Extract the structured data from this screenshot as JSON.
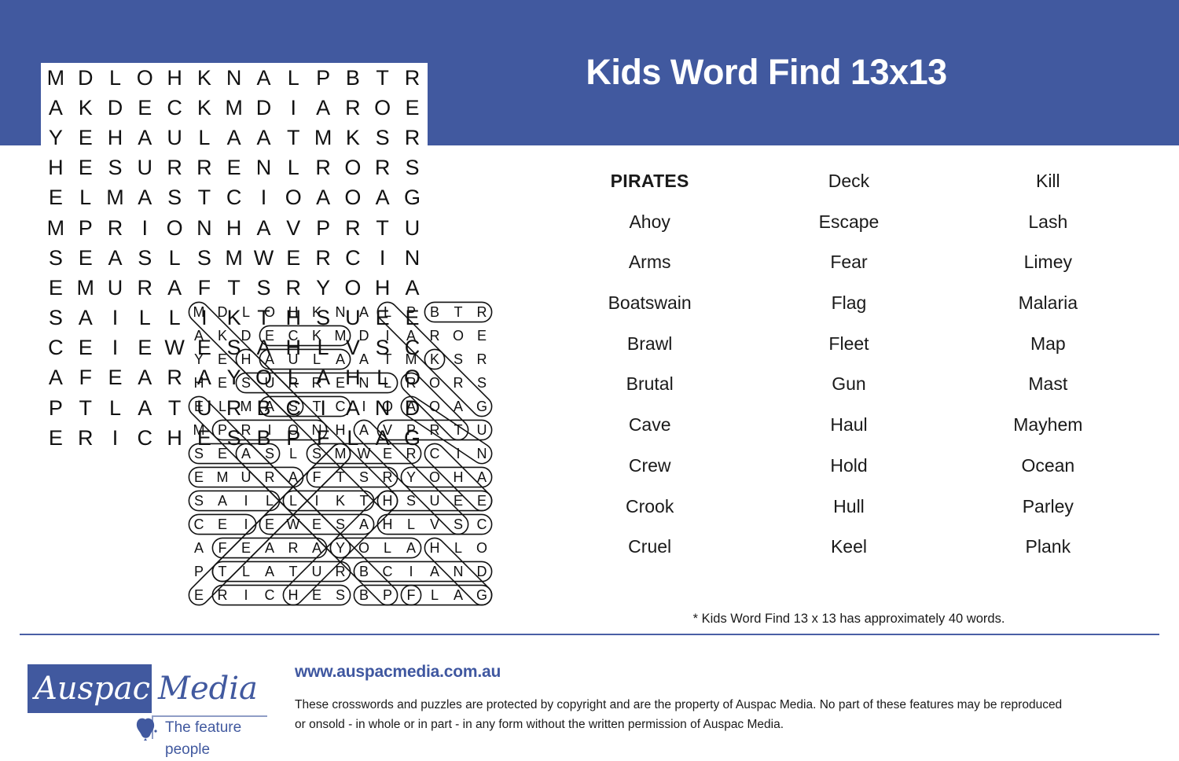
{
  "header": {
    "title": "Kids Word Find 13x13",
    "background_color": "#41599f",
    "title_color": "#ffffff"
  },
  "grid": {
    "size": "13x13",
    "rows": [
      [
        "M",
        "D",
        "L",
        "O",
        "H",
        "K",
        "N",
        "A",
        "L",
        "P",
        "B",
        "T",
        "R"
      ],
      [
        "A",
        "K",
        "D",
        "E",
        "C",
        "K",
        "M",
        "D",
        "I",
        "A",
        "R",
        "O",
        "E"
      ],
      [
        "Y",
        "E",
        "H",
        "A",
        "U",
        "L",
        "A",
        "A",
        "T",
        "M",
        "K",
        "S",
        "R"
      ],
      [
        "H",
        "E",
        "S",
        "U",
        "R",
        "R",
        "E",
        "N",
        "L",
        "R",
        "O",
        "R",
        "S"
      ],
      [
        "E",
        "L",
        "M",
        "A",
        "S",
        "T",
        "C",
        "I",
        "O",
        "A",
        "O",
        "A",
        "G"
      ],
      [
        "M",
        "P",
        "R",
        "I",
        "O",
        "N",
        "H",
        "A",
        "V",
        "P",
        "R",
        "T",
        "U"
      ],
      [
        "S",
        "E",
        "A",
        "S",
        "L",
        "S",
        "M",
        "W",
        "E",
        "R",
        "C",
        "I",
        "N"
      ],
      [
        "E",
        "M",
        "U",
        "R",
        "A",
        "F",
        "T",
        "S",
        "R",
        "Y",
        "O",
        "H",
        "A"
      ],
      [
        "S",
        "A",
        "I",
        "L",
        "L",
        "I",
        "K",
        "T",
        "H",
        "S",
        "U",
        "E",
        "E"
      ],
      [
        "C",
        "E",
        "I",
        "E",
        "W",
        "E",
        "S",
        "A",
        "H",
        "L",
        "V",
        "S",
        "C"
      ],
      [
        "A",
        "F",
        "E",
        "A",
        "R",
        "A",
        "Y",
        "O",
        "L",
        "A",
        "H",
        "L",
        "O"
      ],
      [
        "P",
        "T",
        "L",
        "A",
        "T",
        "U",
        "R",
        "B",
        "C",
        "I",
        "A",
        "N",
        "D"
      ],
      [
        "E",
        "R",
        "I",
        "C",
        "H",
        "E",
        "S",
        "B",
        "P",
        "F",
        "L",
        "A",
        "G"
      ]
    ]
  },
  "solution": {
    "caption": "answer-key-overlay",
    "rows": [
      [
        "M",
        "D",
        "L",
        "O",
        "H",
        "K",
        "N",
        "A",
        "L",
        "P",
        "B",
        "T",
        "R"
      ],
      [
        "A",
        "K",
        "D",
        "E",
        "C",
        "K",
        "M",
        "D",
        "I",
        "A",
        "R",
        "O",
        "E"
      ],
      [
        "Y",
        "E",
        "H",
        "A",
        "U",
        "L",
        "A",
        "A",
        "T",
        "M",
        "K",
        "S",
        "R"
      ],
      [
        "H",
        "E",
        "S",
        "U",
        "R",
        "R",
        "E",
        "N",
        "L",
        "R",
        "O",
        "R",
        "S"
      ],
      [
        "E",
        "L",
        "M",
        "A",
        "S",
        "T",
        "C",
        "I",
        "O",
        "A",
        "O",
        "A",
        "G"
      ],
      [
        "M",
        "P",
        "R",
        "I",
        "O",
        "N",
        "H",
        "A",
        "V",
        "P",
        "R",
        "T",
        "U"
      ],
      [
        "S",
        "E",
        "A",
        "S",
        "L",
        "S",
        "M",
        "W",
        "E",
        "R",
        "C",
        "I",
        "N"
      ],
      [
        "E",
        "M",
        "U",
        "R",
        "A",
        "F",
        "T",
        "S",
        "R",
        "Y",
        "O",
        "H",
        "A"
      ],
      [
        "S",
        "A",
        "I",
        "L",
        "L",
        "I",
        "K",
        "T",
        "H",
        "S",
        "U",
        "E",
        "E"
      ],
      [
        "C",
        "E",
        "I",
        "E",
        "W",
        "E",
        "S",
        "A",
        "H",
        "L",
        "V",
        "S",
        "C"
      ],
      [
        "A",
        "F",
        "E",
        "A",
        "R",
        "A",
        "Y",
        "O",
        "L",
        "A",
        "H",
        "L",
        "O"
      ],
      [
        "P",
        "T",
        "L",
        "A",
        "T",
        "U",
        "R",
        "B",
        "C",
        "I",
        "A",
        "N",
        "D"
      ],
      [
        "E",
        "R",
        "I",
        "C",
        "H",
        "E",
        "S",
        "B",
        "P",
        "F",
        "L",
        "A",
        "G"
      ]
    ]
  },
  "wordlist": {
    "heading": "PIRATES",
    "columns": [
      [
        "PIRATES",
        "Ahoy",
        "Arms",
        "Boatswain",
        "Brawl",
        "Brutal",
        "Cave",
        "Crew",
        "Crook",
        "Cruel"
      ],
      [
        "Deck",
        "Escape",
        "Fear",
        "Flag",
        "Fleet",
        "Gun",
        "Haul",
        "Hold",
        "Hull",
        "Keel"
      ],
      [
        "Kill",
        "Lash",
        "Limey",
        "Malaria",
        "Map",
        "Mast",
        "Mayhem",
        "Ocean",
        "Parley",
        "Plank"
      ]
    ]
  },
  "note": "* Kids Word Find 13 x 13  has approximately 40 words.",
  "footer": {
    "url": "www.auspacmedia.com.au",
    "copyright_line1": "These crosswords and puzzles are protected by copyright and are the property of Auspac Media. No part of these features may be reproduced",
    "copyright_line2": "or onsold - in whole or in part - in any form without the written permission of Auspac Media.",
    "logo_word1": "Auspac",
    "logo_word2": "Media",
    "logo_tagline": "The feature people",
    "brand_color": "#41599f",
    "link_color": "#3f57a0"
  }
}
